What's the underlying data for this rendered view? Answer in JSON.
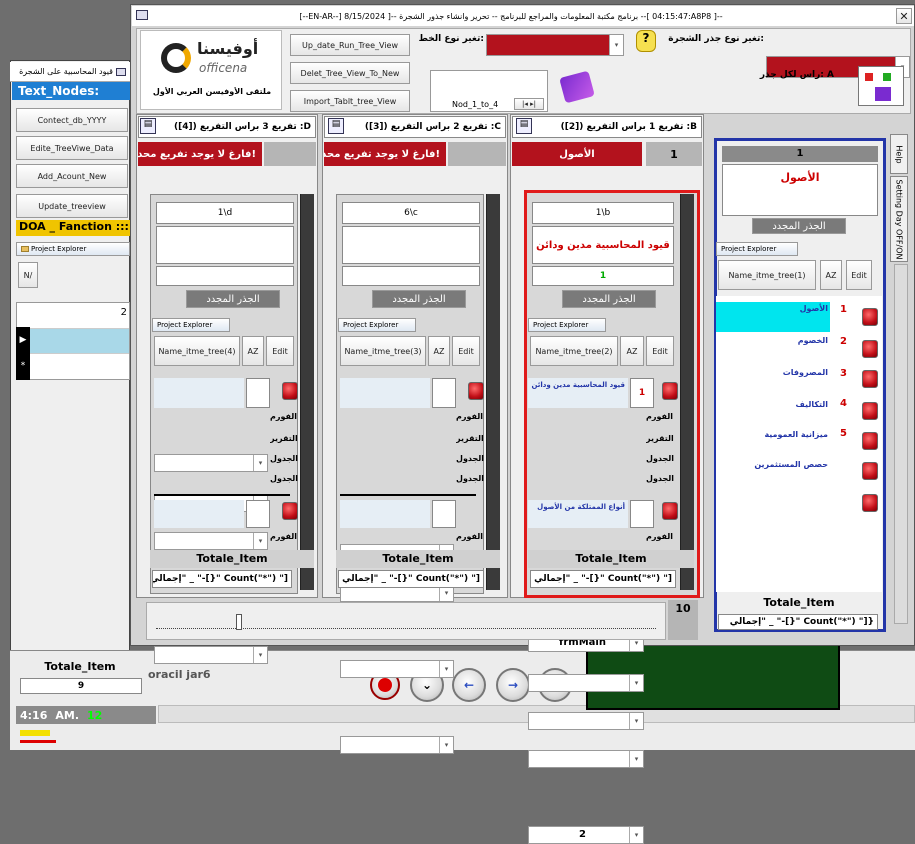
{
  "colors": {
    "accent_red": "#b3121d",
    "blue_border": "#2335a8",
    "green_panel": "#0f4b14",
    "selected_cyan": "#00e5ee"
  },
  "bg_form": {
    "title": "قيود المحاسبية على الشجرة",
    "text_nodes": "Text_Nodes:",
    "buttons": [
      "Contect_db_YYYY",
      "Edite_TreeViwe_Data",
      "Add_Acount_New",
      "Update_treeview"
    ],
    "doa": "DOA _ Fanction ::::::",
    "project_explorer": "Project Explorer",
    "na": "N/",
    "grid_num": "2",
    "totale_label": "Totale_Item",
    "totale_value": "9",
    "oracle": "oracil jar6",
    "clock": {
      "time": "4:16",
      "ampm": "AM.",
      "sec": "12"
    }
  },
  "main": {
    "title": "[--EN-AR--] برنامج مكتبة المعلومات والمراجع للبرنامج -- تحرير وانشاء جذور الشجرة --[ 8/15/2024 --[ 04:15:47:A8P8 ]--",
    "close": "✕",
    "logo": {
      "ar": "أوفيسنا",
      "en": "officena",
      "sub": "ملتقى الأوفيسن العربي الأول"
    },
    "buttons": [
      "Up_date_Run_Tree_View",
      "Delet_Tree_View_To_New",
      "Import_Tablt_tree_View"
    ],
    "line_label": "تغير نوع الخط:",
    "root_type_label": "تغير نوع جذر الشجرة:",
    "root_head": "رأس لكل جذر: A",
    "nod_label": "Nod_1_to_4",
    "nav_nums": "|◂ ▸|",
    "page_num": "10",
    "side_tabs": [
      "Help",
      "Setting Day OFF/ON"
    ]
  },
  "columns": [
    {
      "header": "تفريع 3 براس التفريع ([4]) :D",
      "red": "فارغ لا يوجد تفريع محددا!",
      "num": "",
      "field1": "1\\d",
      "field2": "",
      "field3": "",
      "root_btn": "الجذر المجدد",
      "pe": "Project Explorer",
      "name_btn": "Name_itme_tree(4)",
      "az": "AZ",
      "edit": "Edit",
      "item_name": "",
      "item_num": "",
      "labels": [
        "الفورم",
        "التقرير",
        "الجدول",
        "الجدول"
      ],
      "combo0": "",
      "item2": "",
      "item2_num": "",
      "label5": "الفورم",
      "combo5": "",
      "total_label": "Totale_Item",
      "total_expr": "إجمالي\" _ \"-[}\" Count(\"*\") \"]"
    },
    {
      "header": "تفريع 2 براس التفريع ([3]) :C",
      "red": "فارغ لا يوجد تفريع محددا!",
      "num": "",
      "field1": "6\\c",
      "field2": "",
      "field3": "",
      "root_btn": "الجذر المجدد",
      "pe": "Project Explorer",
      "name_btn": "Name_itme_tree(3)",
      "az": "AZ",
      "edit": "Edit",
      "item_name": "",
      "item_num": "",
      "labels": [
        "الفورم",
        "التقرير",
        "الجدول",
        "الجدول"
      ],
      "combo0": "",
      "item2": "",
      "item2_num": "",
      "label5": "الفورم",
      "combo5": "",
      "total_label": "Totale_Item",
      "total_expr": "إجمالي\" _ \"-[}\" Count(\"*\") \"]"
    },
    {
      "header": "تفريع 1 براس التفريع ([2]) :B",
      "red": "الأصول",
      "num": "1",
      "field1": "1\\b",
      "field2": "قيود المحاسبية مدين ودائن",
      "field3": "1",
      "root_btn": "الجذر المجدد",
      "pe": "Project Explorer",
      "name_btn": "Name_itme_tree(2)",
      "az": "AZ",
      "edit": "Edit",
      "item_name": "قيود المحاسبية مدين ودائن",
      "item_num": "1",
      "labels": [
        "الفورم",
        "التقرير",
        "الجدول",
        "الجدول"
      ],
      "combo0": "frmMain",
      "item2": "أنواع الممتلكة من الأصول",
      "item2_num": "",
      "label5": "الفورم",
      "combo5": "2",
      "total_label": "Totale_Item",
      "total_expr": "إجمالي\" _ \"-[}\" Count(\"*\") \"]"
    }
  ],
  "root_panel": {
    "num": "1",
    "name": "الأصول",
    "root_btn": "الجذر المجدد",
    "pe": "Project Explorer",
    "name_btn": "Name_itme_tree(1)",
    "az": "AZ",
    "edit": "Edit",
    "items": [
      {
        "name": "الأصول",
        "num": "1"
      },
      {
        "name": "الخصوم",
        "num": "2"
      },
      {
        "name": "المصروفات",
        "num": "3"
      },
      {
        "name": "التكاليف",
        "num": "4"
      },
      {
        "name": "ميزانية العمومية",
        "num": "5"
      },
      {
        "name": "حصص المستثمرين",
        "num": ""
      },
      {
        "name": "",
        "num": ""
      }
    ],
    "total_label": "Totale_Item",
    "total_expr": "إجمالي\" _ \"-[}\" Count(\"*\") \"]}"
  }
}
